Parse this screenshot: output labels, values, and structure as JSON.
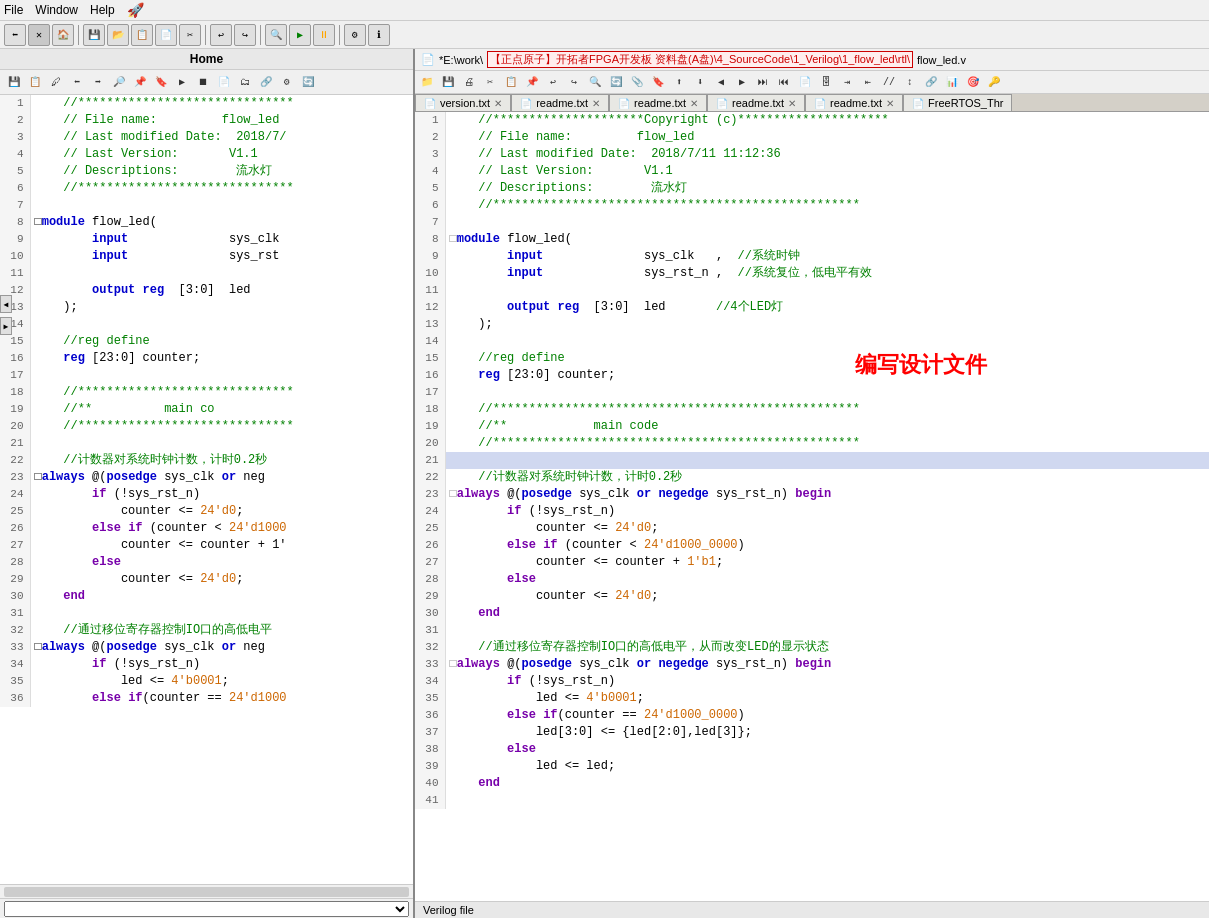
{
  "menubar": {
    "items": [
      "File",
      "Window",
      "Help"
    ],
    "help_icon": "?"
  },
  "left_panel": {
    "header": "Home",
    "code_lines": [
      {
        "num": 1,
        "text": "    //******************************",
        "type": "star"
      },
      {
        "num": 2,
        "text": "    // File name:         flow_led",
        "type": "comment"
      },
      {
        "num": 3,
        "text": "    // Last modified Date:  2018/7/",
        "type": "comment"
      },
      {
        "num": 4,
        "text": "    // Last Version:       V1.1",
        "type": "comment"
      },
      {
        "num": 5,
        "text": "    // Descriptions:        流水灯",
        "type": "comment"
      },
      {
        "num": 6,
        "text": "    //******************************",
        "type": "star"
      },
      {
        "num": 7,
        "text": "",
        "type": "blank"
      },
      {
        "num": 8,
        "text": "□module flow_led(",
        "type": "code",
        "collapse": true
      },
      {
        "num": 9,
        "text": "        input              sys_clk",
        "type": "code"
      },
      {
        "num": 10,
        "text": "        input              sys_rst",
        "type": "code"
      },
      {
        "num": 11,
        "text": "",
        "type": "blank"
      },
      {
        "num": 12,
        "text": "        output reg  [3:0]  led",
        "type": "code"
      },
      {
        "num": 13,
        "text": "    );",
        "type": "code"
      },
      {
        "num": 14,
        "text": "",
        "type": "blank"
      },
      {
        "num": 15,
        "text": "    //reg define",
        "type": "comment"
      },
      {
        "num": 16,
        "text": "    reg [23:0] counter;",
        "type": "code"
      },
      {
        "num": 17,
        "text": "",
        "type": "blank"
      },
      {
        "num": 18,
        "text": "    //******************************",
        "type": "star"
      },
      {
        "num": 19,
        "text": "    //**          main co",
        "type": "comment"
      },
      {
        "num": 20,
        "text": "    //******************************",
        "type": "star"
      },
      {
        "num": 21,
        "text": "",
        "type": "blank"
      },
      {
        "num": 22,
        "text": "    //计数器对系统时钟计数，计时0.2秒",
        "type": "comment"
      },
      {
        "num": 23,
        "text": "□always @(posedge sys_clk or neg",
        "type": "code",
        "collapse": true
      },
      {
        "num": 24,
        "text": "        if (!sys_rst_n)",
        "type": "code"
      },
      {
        "num": 25,
        "text": "            counter <= 24'd0;",
        "type": "code"
      },
      {
        "num": 26,
        "text": "        else if (counter < 24'd1000",
        "type": "code"
      },
      {
        "num": 27,
        "text": "            counter <= counter + 1'",
        "type": "code"
      },
      {
        "num": 28,
        "text": "        else",
        "type": "code"
      },
      {
        "num": 29,
        "text": "            counter <= 24'd0;",
        "type": "code"
      },
      {
        "num": 30,
        "text": "    end",
        "type": "code"
      },
      {
        "num": 31,
        "text": "",
        "type": "blank"
      },
      {
        "num": 32,
        "text": "    //通过移位寄存器控制IO口的高低电平",
        "type": "comment"
      },
      {
        "num": 33,
        "text": "□always @(posedge sys_clk or neg",
        "type": "code",
        "collapse": true
      },
      {
        "num": 34,
        "text": "        if (!sys_rst_n)",
        "type": "code"
      },
      {
        "num": 35,
        "text": "            led <= 4'b0001;",
        "type": "code"
      },
      {
        "num": 36,
        "text": "        else if(counter == 24'd1000",
        "type": "code"
      }
    ]
  },
  "right_panel": {
    "title_path": "*E:\\work\\",
    "title_highlight": "【正点原子】开拓者FPGA开发板 资料盘(A盘)\\4_SourceCode\\1_Verilog\\1_flow_led\\rtl\\",
    "title_file": "flow_led.v",
    "tabs": [
      {
        "label": "version.txt",
        "closable": true,
        "active": false
      },
      {
        "label": "readme.txt",
        "closable": true,
        "active": false
      },
      {
        "label": "readme.txt",
        "closable": true,
        "active": false
      },
      {
        "label": "readme.txt",
        "closable": true,
        "active": false
      },
      {
        "label": "readme.txt",
        "closable": true,
        "active": false
      },
      {
        "label": "FreeRTOS_Thr",
        "closable": false,
        "active": false
      }
    ],
    "code_lines": [
      {
        "num": 1,
        "text": "    //*********************Copyright (c)*********************",
        "type": "star"
      },
      {
        "num": 2,
        "text": "    // File name:         flow_led",
        "type": "comment"
      },
      {
        "num": 3,
        "text": "    // Last modified Date:  2018/7/11 11:12:36",
        "type": "comment"
      },
      {
        "num": 4,
        "text": "    // Last Version:       V1.1",
        "type": "comment"
      },
      {
        "num": 5,
        "text": "    // Descriptions:        流水灯",
        "type": "comment"
      },
      {
        "num": 6,
        "text": "    //***************************************************",
        "type": "star"
      },
      {
        "num": 7,
        "text": "",
        "type": "blank"
      },
      {
        "num": 8,
        "text": "□module flow_led(",
        "type": "module",
        "collapse": true
      },
      {
        "num": 9,
        "text": "        input              sys_clk   ,  //系统时钟",
        "type": "input_line"
      },
      {
        "num": 10,
        "text": "        input              sys_rst_n ,  //系统复位，低电平有效",
        "type": "input_line"
      },
      {
        "num": 11,
        "text": "",
        "type": "blank"
      },
      {
        "num": 12,
        "text": "        output reg  [3:0]  led       //4个LED灯",
        "type": "output_comment"
      },
      {
        "num": 13,
        "text": "    );",
        "type": "code"
      },
      {
        "num": 14,
        "text": "",
        "type": "blank"
      },
      {
        "num": 15,
        "text": "    //reg define",
        "type": "comment"
      },
      {
        "num": 16,
        "text": "    reg [23:0] counter;",
        "type": "code"
      },
      {
        "num": 17,
        "text": "",
        "type": "blank"
      },
      {
        "num": 18,
        "text": "    //***************************************************",
        "type": "star"
      },
      {
        "num": 19,
        "text": "    //**            main code",
        "type": "comment"
      },
      {
        "num": 20,
        "text": "    //***************************************************",
        "type": "star"
      },
      {
        "num": 21,
        "text": "",
        "type": "selected"
      },
      {
        "num": 22,
        "text": "    //计数器对系统时钟计数，计时0.2秒",
        "type": "comment_zh"
      },
      {
        "num": 23,
        "text": "□always @(posedge sys_clk or negedge sys_rst_n) begin",
        "type": "always",
        "collapse": true
      },
      {
        "num": 24,
        "text": "        if (!sys_rst_n)",
        "type": "code"
      },
      {
        "num": 25,
        "text": "            counter <= 24'd0;",
        "type": "code_assign"
      },
      {
        "num": 26,
        "text": "        else if (counter < 24'd1000_0000)",
        "type": "code"
      },
      {
        "num": 27,
        "text": "            counter <= counter + 1'b1;",
        "type": "code_assign"
      },
      {
        "num": 28,
        "text": "        else",
        "type": "code"
      },
      {
        "num": 29,
        "text": "            counter <= 24'd0;",
        "type": "code_assign"
      },
      {
        "num": 30,
        "text": "    end",
        "type": "end"
      },
      {
        "num": 31,
        "text": "",
        "type": "blank"
      },
      {
        "num": 32,
        "text": "    //通过移位寄存器控制IO口的高低电平，从而改变LED的显示状态",
        "type": "comment_zh"
      },
      {
        "num": 33,
        "text": "□always @(posedge sys_clk or negedge sys_rst_n) begin",
        "type": "always",
        "collapse": true
      },
      {
        "num": 34,
        "text": "        if (!sys_rst_n)",
        "type": "code"
      },
      {
        "num": 35,
        "text": "            led <= 4'b0001;",
        "type": "code_assign"
      },
      {
        "num": 36,
        "text": "        else if(counter == 24'd1000_0000)",
        "type": "code"
      },
      {
        "num": 37,
        "text": "            led[3:0] <= {led[2:0],led[3]};",
        "type": "code_assign"
      },
      {
        "num": 38,
        "text": "        else",
        "type": "code"
      },
      {
        "num": 39,
        "text": "            led <= led;",
        "type": "code_assign"
      },
      {
        "num": 40,
        "text": "    end",
        "type": "end"
      },
      {
        "num": 41,
        "text": "",
        "type": "blank"
      }
    ],
    "overlay_text": "编写设计文件",
    "status": "Verilog file"
  }
}
